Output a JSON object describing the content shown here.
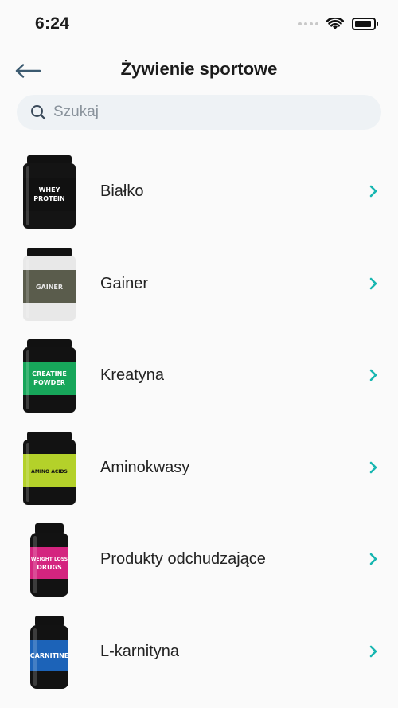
{
  "status": {
    "time": "6:24"
  },
  "header": {
    "title": "Żywienie sportowe"
  },
  "search": {
    "placeholder": "Szukaj",
    "value": ""
  },
  "categories": [
    {
      "label": "Białko",
      "product_text": [
        "WHEY",
        "PROTEIN"
      ],
      "jar_color": "#141414",
      "label_color": "#111111",
      "text_color": "#ffffff",
      "icon": "whey-protein-jar-icon"
    },
    {
      "label": "Gainer",
      "product_text": [
        "GAINER"
      ],
      "jar_color": "#e8e8e8",
      "label_color": "#5a5c4c",
      "text_color": "#e6e6e6",
      "icon": "gainer-jar-icon"
    },
    {
      "label": "Kreatyna",
      "product_text": [
        "CREATINE",
        "POWDER"
      ],
      "jar_color": "#121212",
      "label_color": "#17a65a",
      "text_color": "#ffffff",
      "icon": "creatine-jar-icon"
    },
    {
      "label": "Aminokwasy",
      "product_text": [
        "AMINO ACIDS"
      ],
      "jar_color": "#121212",
      "label_color": "#b4d12a",
      "text_color": "#111111",
      "icon": "amino-acids-jar-icon"
    },
    {
      "label": "Produkty odchudzające",
      "product_text": [
        "WEIGHT LOSS",
        "DRUGS"
      ],
      "jar_color": "#121212",
      "label_color": "#d4247f",
      "text_color": "#ffffff",
      "icon": "weight-loss-bottle-icon"
    },
    {
      "label": "L-karnityna",
      "product_text": [
        "CARNITINE"
      ],
      "jar_color": "#121212",
      "label_color": "#1c63b8",
      "text_color": "#ffffff",
      "icon": "carnitine-bottle-icon"
    }
  ],
  "colors": {
    "accent": "#17b6b0",
    "back_arrow": "#3b5a70",
    "search_bg": "#eef2f5"
  }
}
